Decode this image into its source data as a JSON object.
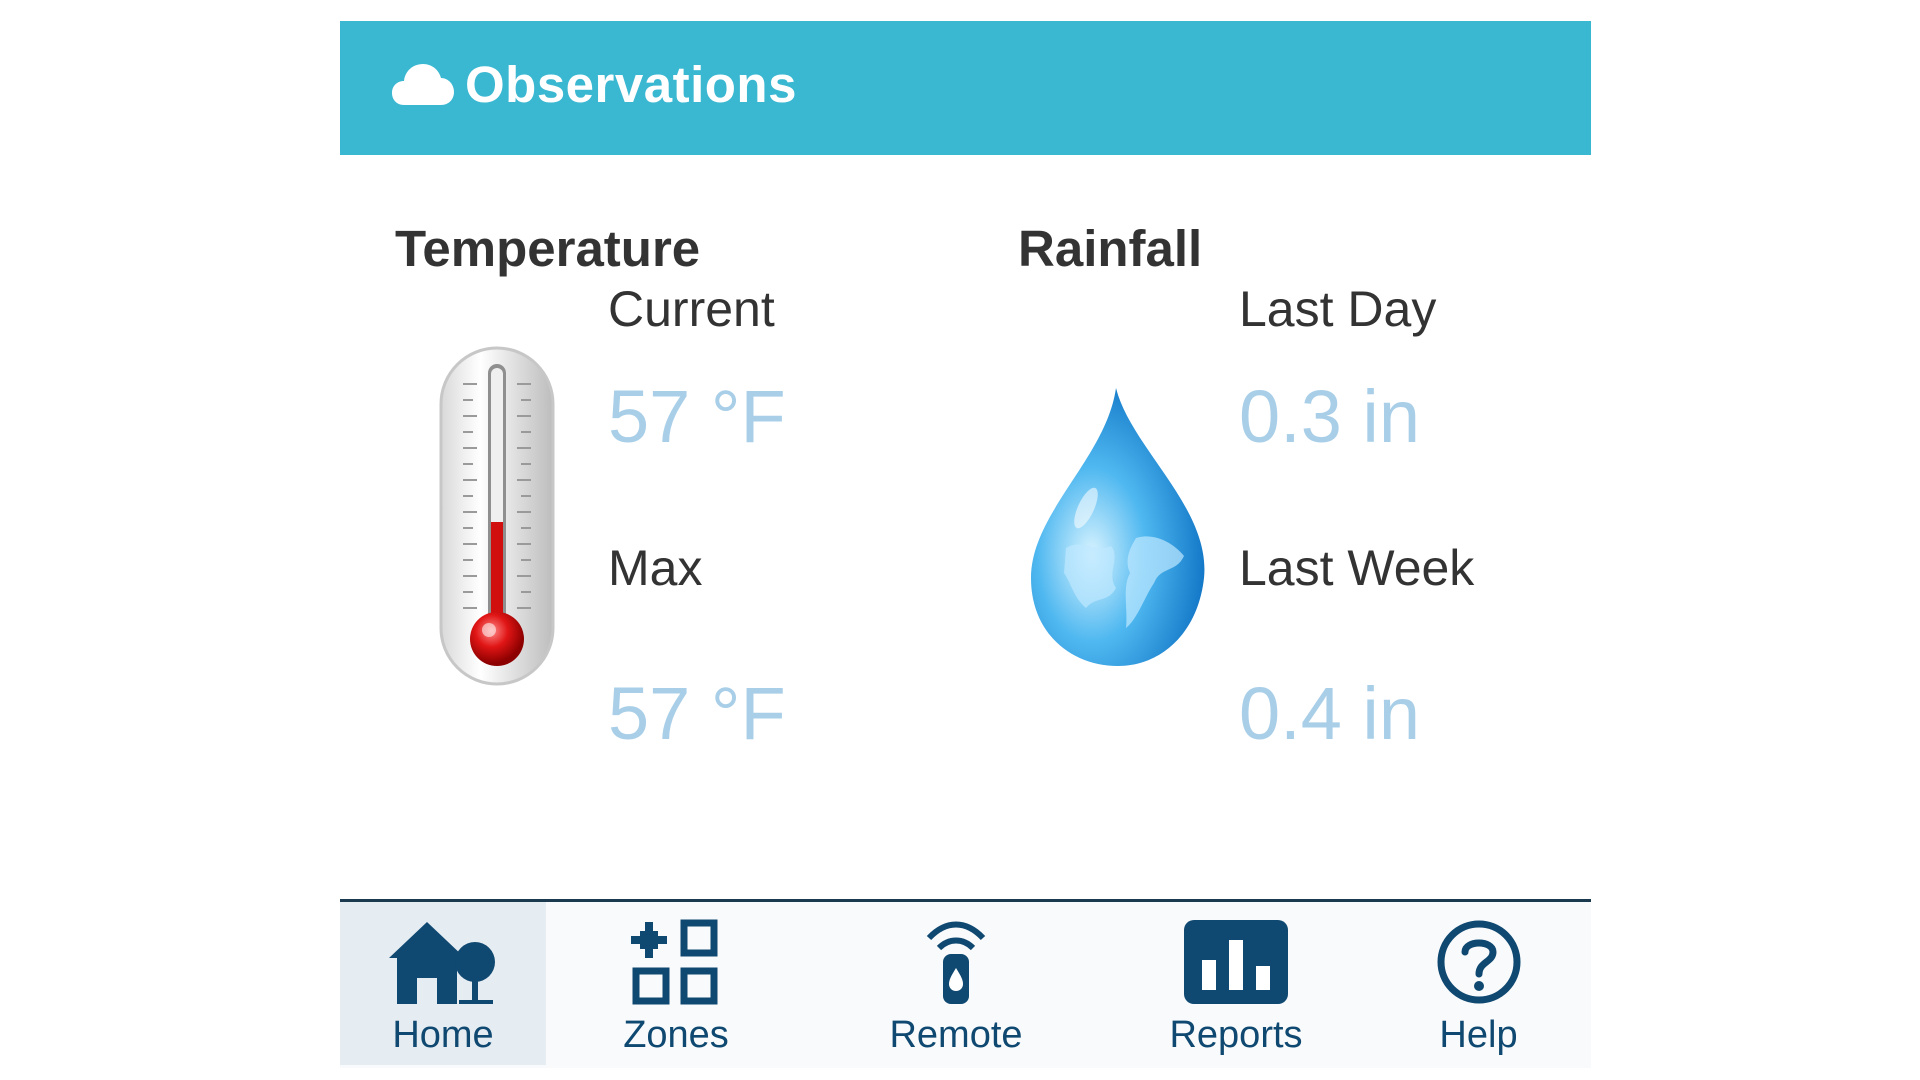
{
  "header": {
    "title": "Observations",
    "icon": "cloud-icon"
  },
  "temperature": {
    "title": "Temperature",
    "current_label": "Current",
    "current_value": "57 °F",
    "max_label": "Max",
    "max_value": "57 °F",
    "icon": "thermometer-icon"
  },
  "rainfall": {
    "title": "Rainfall",
    "last_day_label": "Last Day",
    "last_day_value": "0.3 in",
    "last_week_label": "Last Week",
    "last_week_value": "0.4 in",
    "icon": "water-drop-globe-icon"
  },
  "nav": {
    "items": [
      {
        "label": "Home",
        "icon": "home-icon",
        "active": true
      },
      {
        "label": "Zones",
        "icon": "zones-icon",
        "active": false
      },
      {
        "label": "Remote",
        "icon": "remote-icon",
        "active": false
      },
      {
        "label": "Reports",
        "icon": "reports-icon",
        "active": false
      },
      {
        "label": "Help",
        "icon": "help-icon",
        "active": false
      }
    ]
  },
  "colors": {
    "header_bg": "#3ab7d1",
    "value_text": "#a9cfe8",
    "nav_text": "#0f4870",
    "active_bg": "#e5ecf2"
  }
}
